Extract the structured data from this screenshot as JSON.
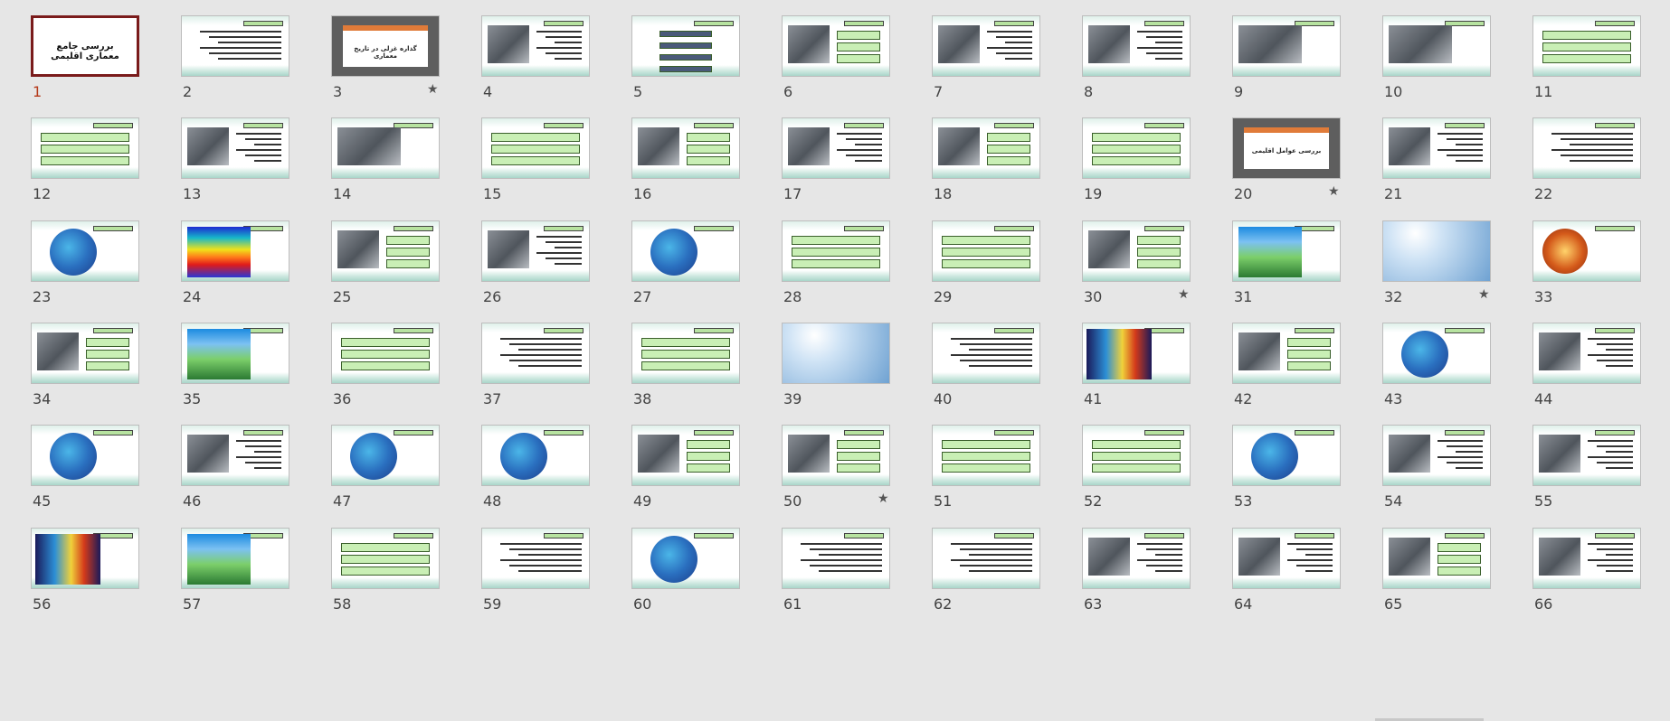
{
  "slides": [
    {
      "number": "1",
      "kind": "title",
      "title": "بررسی جامع معماری اقلیمی",
      "selected": true,
      "has_transition": false
    },
    {
      "number": "2",
      "kind": "list",
      "selected": false,
      "has_transition": false
    },
    {
      "number": "3",
      "kind": "section",
      "title": "گذاره غزلی در تاریخ معماری",
      "selected": false,
      "has_transition": true
    },
    {
      "number": "4",
      "kind": "photo-text",
      "selected": false,
      "has_transition": false
    },
    {
      "number": "5",
      "kind": "bars",
      "selected": false,
      "has_transition": false
    },
    {
      "number": "6",
      "kind": "photo-boxes",
      "selected": false,
      "has_transition": false
    },
    {
      "number": "7",
      "kind": "photo-text",
      "selected": false,
      "has_transition": false
    },
    {
      "number": "8",
      "kind": "photo-text",
      "selected": false,
      "has_transition": false
    },
    {
      "number": "9",
      "kind": "photo-wide",
      "selected": false,
      "has_transition": false
    },
    {
      "number": "10",
      "kind": "photo-wide",
      "selected": false,
      "has_transition": false
    },
    {
      "number": "11",
      "kind": "boxes",
      "selected": false,
      "has_transition": false
    },
    {
      "number": "12",
      "kind": "boxes",
      "selected": false,
      "has_transition": false
    },
    {
      "number": "13",
      "kind": "photo-text",
      "selected": false,
      "has_transition": false
    },
    {
      "number": "14",
      "kind": "photo-wide",
      "selected": false,
      "has_transition": false
    },
    {
      "number": "15",
      "kind": "boxes",
      "selected": false,
      "has_transition": false
    },
    {
      "number": "16",
      "kind": "photo-boxes",
      "selected": false,
      "has_transition": false
    },
    {
      "number": "17",
      "kind": "photo-text",
      "selected": false,
      "has_transition": false
    },
    {
      "number": "18",
      "kind": "photo-boxes",
      "selected": false,
      "has_transition": false
    },
    {
      "number": "19",
      "kind": "boxes",
      "selected": false,
      "has_transition": false
    },
    {
      "number": "20",
      "kind": "section",
      "title": "بررسی عوامل اقلیمی",
      "selected": false,
      "has_transition": true
    },
    {
      "number": "21",
      "kind": "photo-text",
      "selected": false,
      "has_transition": false
    },
    {
      "number": "22",
      "kind": "text",
      "selected": false,
      "has_transition": false
    },
    {
      "number": "23",
      "kind": "globe",
      "selected": false,
      "has_transition": false
    },
    {
      "number": "24",
      "kind": "heatmap",
      "selected": false,
      "has_transition": false
    },
    {
      "number": "25",
      "kind": "photo-boxes",
      "selected": false,
      "has_transition": false
    },
    {
      "number": "26",
      "kind": "photo-text",
      "selected": false,
      "has_transition": false
    },
    {
      "number": "27",
      "kind": "globe",
      "selected": false,
      "has_transition": false
    },
    {
      "number": "28",
      "kind": "boxes",
      "selected": false,
      "has_transition": false
    },
    {
      "number": "29",
      "kind": "boxes",
      "selected": false,
      "has_transition": false
    },
    {
      "number": "30",
      "kind": "photo-boxes",
      "selected": false,
      "has_transition": true
    },
    {
      "number": "31",
      "kind": "map",
      "selected": false,
      "has_transition": false
    },
    {
      "number": "32",
      "kind": "sky",
      "selected": false,
      "has_transition": true
    },
    {
      "number": "33",
      "kind": "sun",
      "selected": false,
      "has_transition": false
    },
    {
      "number": "34",
      "kind": "photo-boxes",
      "selected": false,
      "has_transition": false
    },
    {
      "number": "35",
      "kind": "map",
      "selected": false,
      "has_transition": false
    },
    {
      "number": "36",
      "kind": "boxes",
      "selected": false,
      "has_transition": false
    },
    {
      "number": "37",
      "kind": "text",
      "selected": false,
      "has_transition": false
    },
    {
      "number": "38",
      "kind": "boxes",
      "selected": false,
      "has_transition": false
    },
    {
      "number": "39",
      "kind": "sky",
      "selected": false,
      "has_transition": false
    },
    {
      "number": "40",
      "kind": "text",
      "selected": false,
      "has_transition": false
    },
    {
      "number": "41",
      "kind": "world",
      "selected": false,
      "has_transition": false
    },
    {
      "number": "42",
      "kind": "photo-boxes",
      "selected": false,
      "has_transition": false
    },
    {
      "number": "43",
      "kind": "globe",
      "selected": false,
      "has_transition": false
    },
    {
      "number": "44",
      "kind": "photo-text",
      "selected": false,
      "has_transition": false
    },
    {
      "number": "45",
      "kind": "globe",
      "selected": false,
      "has_transition": false
    },
    {
      "number": "46",
      "kind": "photo-text",
      "selected": false,
      "has_transition": false
    },
    {
      "number": "47",
      "kind": "globe",
      "selected": false,
      "has_transition": false
    },
    {
      "number": "48",
      "kind": "globe",
      "selected": false,
      "has_transition": false
    },
    {
      "number": "49",
      "kind": "photo-boxes",
      "selected": false,
      "has_transition": false
    },
    {
      "number": "50",
      "kind": "photo-boxes",
      "selected": false,
      "has_transition": true
    },
    {
      "number": "51",
      "kind": "boxes",
      "selected": false,
      "has_transition": false
    },
    {
      "number": "52",
      "kind": "boxes",
      "selected": false,
      "has_transition": false
    },
    {
      "number": "53",
      "kind": "globe",
      "selected": false,
      "has_transition": false
    },
    {
      "number": "54",
      "kind": "photo-text",
      "selected": false,
      "has_transition": false
    },
    {
      "number": "55",
      "kind": "photo-text",
      "selected": false,
      "has_transition": false
    },
    {
      "number": "56",
      "kind": "world",
      "selected": false,
      "has_transition": false
    },
    {
      "number": "57",
      "kind": "map",
      "selected": false,
      "has_transition": false
    },
    {
      "number": "58",
      "kind": "boxes",
      "selected": false,
      "has_transition": false
    },
    {
      "number": "59",
      "kind": "text",
      "selected": false,
      "has_transition": false
    },
    {
      "number": "60",
      "kind": "globe",
      "selected": false,
      "has_transition": false
    },
    {
      "number": "61",
      "kind": "text",
      "selected": false,
      "has_transition": false
    },
    {
      "number": "62",
      "kind": "text",
      "selected": false,
      "has_transition": false
    },
    {
      "number": "63",
      "kind": "photo-text",
      "selected": false,
      "has_transition": false
    },
    {
      "number": "64",
      "kind": "photo-text",
      "selected": false,
      "has_transition": false
    },
    {
      "number": "65",
      "kind": "photo-boxes",
      "selected": false,
      "has_transition": false
    },
    {
      "number": "66",
      "kind": "photo-text",
      "selected": false,
      "has_transition": false
    }
  ],
  "colors": {
    "background": "#e6e6e6",
    "selected_border": "#7a1b1b",
    "selected_number": "#b5391a",
    "number": "#444444"
  },
  "icons": {
    "transition": "star-icon"
  }
}
